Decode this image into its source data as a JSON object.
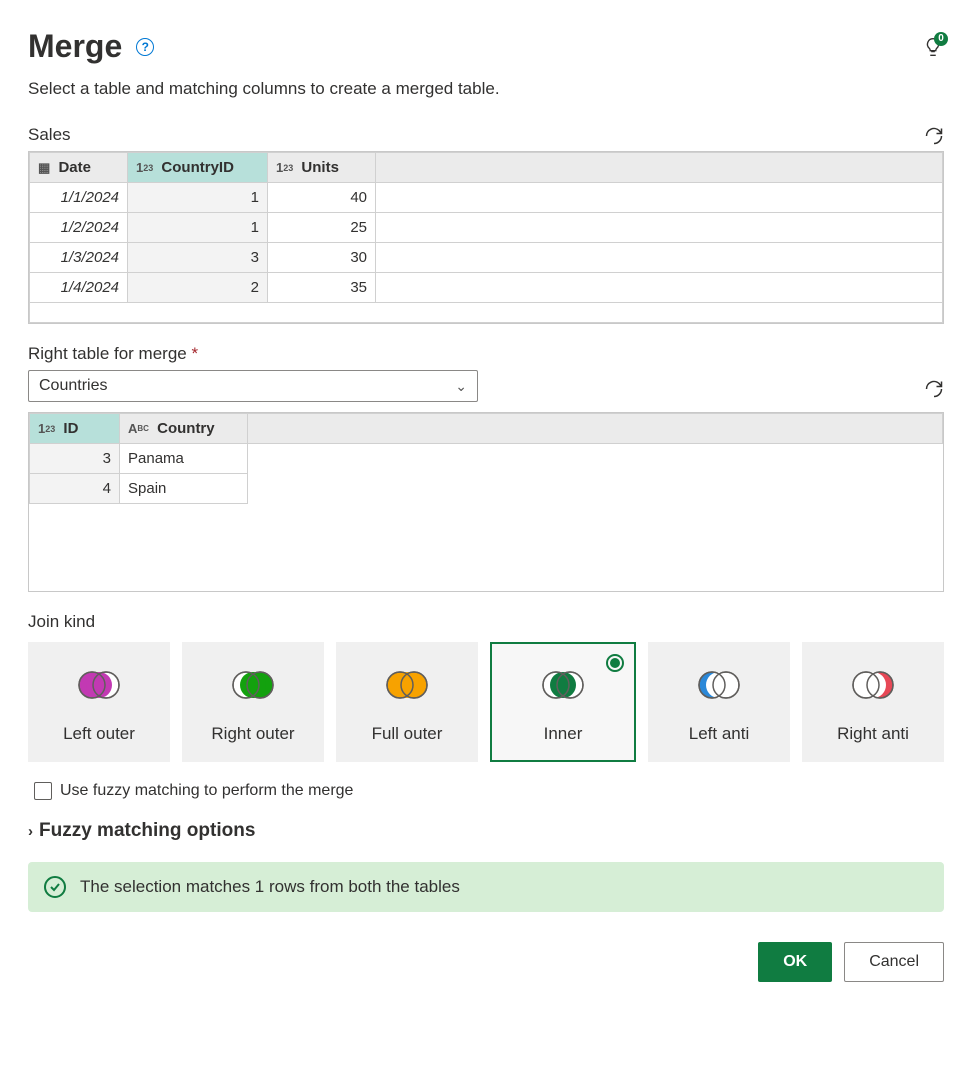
{
  "header": {
    "title": "Merge",
    "badge": "0"
  },
  "subtitle": "Select a table and matching columns to create a merged table.",
  "leftTable": {
    "name": "Sales",
    "columns": [
      {
        "label": "Date",
        "type": "date",
        "selected": false
      },
      {
        "label": "CountryID",
        "type": "number",
        "selected": true
      },
      {
        "label": "Units",
        "type": "number",
        "selected": false
      }
    ],
    "rows": [
      {
        "Date": "1/1/2024",
        "CountryID": "1",
        "Units": "40"
      },
      {
        "Date": "1/2/2024",
        "CountryID": "1",
        "Units": "25"
      },
      {
        "Date": "1/3/2024",
        "CountryID": "3",
        "Units": "30"
      },
      {
        "Date": "1/4/2024",
        "CountryID": "2",
        "Units": "35"
      }
    ]
  },
  "rightSection": {
    "label": "Right table for merge",
    "selected": "Countries",
    "columns": [
      {
        "label": "ID",
        "type": "number",
        "selected": true
      },
      {
        "label": "Country",
        "type": "text",
        "selected": false
      }
    ],
    "rows": [
      {
        "ID": "3",
        "Country": "Panama"
      },
      {
        "ID": "4",
        "Country": "Spain"
      }
    ]
  },
  "joinKind": {
    "label": "Join kind",
    "options": [
      "Left outer",
      "Right outer",
      "Full outer",
      "Inner",
      "Left anti",
      "Right anti"
    ],
    "selected": "Inner",
    "colors": {
      "Left outer": "#c239b3",
      "Right outer": "#13a10e",
      "Full outer": "#f7a200",
      "Inner": "#107c41",
      "Left anti": "#2b88d8",
      "Right anti": "#e74856"
    }
  },
  "fuzzy": {
    "checkboxLabel": "Use fuzzy matching to perform the merge",
    "sectionLabel": "Fuzzy matching options"
  },
  "status": "The selection matches 1 rows from both the tables",
  "buttons": {
    "ok": "OK",
    "cancel": "Cancel"
  }
}
